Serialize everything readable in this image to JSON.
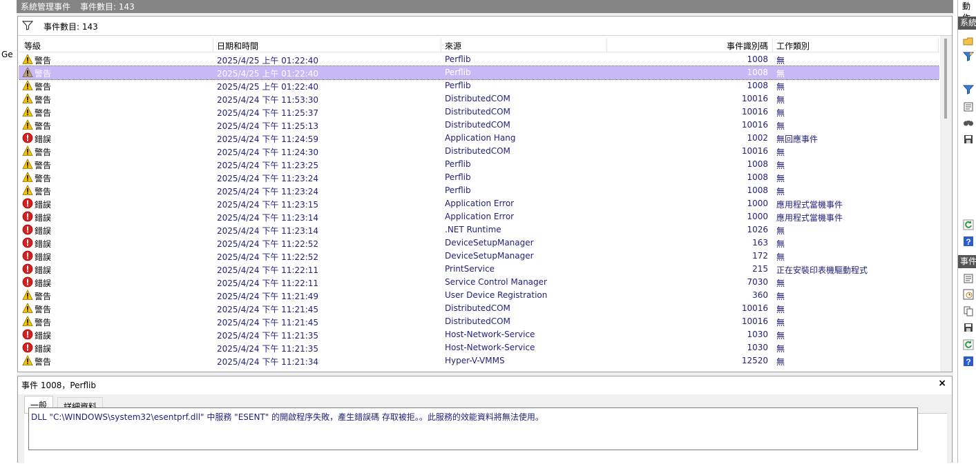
{
  "title_bar": {
    "title": "系統管理事件",
    "count_label": "事件數目: 143"
  },
  "left_strip": {
    "truncated_text": "Ge"
  },
  "filter_bar": {
    "icon": "filter-icon",
    "text": "事件數目: 143"
  },
  "columns": {
    "level": "等級",
    "datetime": "日期和時間",
    "source": "來源",
    "event_id": "事件識別碼",
    "task": "工作類別"
  },
  "events": [
    {
      "level": "警告",
      "type": "warning",
      "datetime": "2025/4/25 上午 01:22:40",
      "source": "Perflib",
      "event_id": "1008",
      "task": "無"
    },
    {
      "level": "警告",
      "type": "warning",
      "datetime": "2025/4/25 上午 01:22:40",
      "source": "Perflib",
      "event_id": "1008",
      "task": "無",
      "selected": true
    },
    {
      "level": "警告",
      "type": "warning",
      "datetime": "2025/4/25 上午 01:22:40",
      "source": "Perflib",
      "event_id": "1008",
      "task": "無"
    },
    {
      "level": "警告",
      "type": "warning",
      "datetime": "2025/4/24 下午 11:53:30",
      "source": "DistributedCOM",
      "event_id": "10016",
      "task": "無"
    },
    {
      "level": "警告",
      "type": "warning",
      "datetime": "2025/4/24 下午 11:25:37",
      "source": "DistributedCOM",
      "event_id": "10016",
      "task": "無"
    },
    {
      "level": "警告",
      "type": "warning",
      "datetime": "2025/4/24 下午 11:25:13",
      "source": "DistributedCOM",
      "event_id": "10016",
      "task": "無"
    },
    {
      "level": "錯誤",
      "type": "error",
      "datetime": "2025/4/24 下午 11:24:59",
      "source": "Application Hang",
      "event_id": "1002",
      "task": "無回應事件"
    },
    {
      "level": "警告",
      "type": "warning",
      "datetime": "2025/4/24 下午 11:24:30",
      "source": "DistributedCOM",
      "event_id": "10016",
      "task": "無"
    },
    {
      "level": "警告",
      "type": "warning",
      "datetime": "2025/4/24 下午 11:23:25",
      "source": "Perflib",
      "event_id": "1008",
      "task": "無"
    },
    {
      "level": "警告",
      "type": "warning",
      "datetime": "2025/4/24 下午 11:23:24",
      "source": "Perflib",
      "event_id": "1008",
      "task": "無"
    },
    {
      "level": "警告",
      "type": "warning",
      "datetime": "2025/4/24 下午 11:23:24",
      "source": "Perflib",
      "event_id": "1008",
      "task": "無"
    },
    {
      "level": "錯誤",
      "type": "error",
      "datetime": "2025/4/24 下午 11:23:15",
      "source": "Application Error",
      "event_id": "1000",
      "task": "應用程式當機事件"
    },
    {
      "level": "錯誤",
      "type": "error",
      "datetime": "2025/4/24 下午 11:23:14",
      "source": "Application Error",
      "event_id": "1000",
      "task": "應用程式當機事件"
    },
    {
      "level": "錯誤",
      "type": "error",
      "datetime": "2025/4/24 下午 11:23:14",
      "source": ".NET Runtime",
      "event_id": "1026",
      "task": "無"
    },
    {
      "level": "錯誤",
      "type": "error",
      "datetime": "2025/4/24 下午 11:22:52",
      "source": "DeviceSetupManager",
      "event_id": "163",
      "task": "無"
    },
    {
      "level": "錯誤",
      "type": "error",
      "datetime": "2025/4/24 下午 11:22:52",
      "source": "DeviceSetupManager",
      "event_id": "172",
      "task": "無"
    },
    {
      "level": "錯誤",
      "type": "error",
      "datetime": "2025/4/24 下午 11:22:11",
      "source": "PrintService",
      "event_id": "215",
      "task": "正在安裝印表機驅動程式"
    },
    {
      "level": "錯誤",
      "type": "error",
      "datetime": "2025/4/24 下午 11:22:11",
      "source": "Service Control Manager",
      "event_id": "7030",
      "task": "無"
    },
    {
      "level": "警告",
      "type": "warning",
      "datetime": "2025/4/24 下午 11:21:49",
      "source": "User Device Registration",
      "event_id": "360",
      "task": "無"
    },
    {
      "level": "警告",
      "type": "warning",
      "datetime": "2025/4/24 下午 11:21:45",
      "source": "DistributedCOM",
      "event_id": "10016",
      "task": "無"
    },
    {
      "level": "警告",
      "type": "warning",
      "datetime": "2025/4/24 下午 11:21:45",
      "source": "DistributedCOM",
      "event_id": "10016",
      "task": "無"
    },
    {
      "level": "錯誤",
      "type": "error",
      "datetime": "2025/4/24 下午 11:21:35",
      "source": "Host-Network-Service",
      "event_id": "1030",
      "task": "無"
    },
    {
      "level": "錯誤",
      "type": "error",
      "datetime": "2025/4/24 下午 11:21:35",
      "source": "Host-Network-Service",
      "event_id": "1030",
      "task": "無"
    },
    {
      "level": "警告",
      "type": "warning",
      "datetime": "2025/4/24 下午 11:21:34",
      "source": "Hyper-V-VMMS",
      "event_id": "12520",
      "task": "無"
    }
  ],
  "detail": {
    "title": "事件 1008，Perflib",
    "close": "×",
    "tabs": {
      "general": "一般",
      "details": "詳細資料"
    },
    "message": "DLL \"C:\\WINDOWS\\system32\\esentprf.dll\" 中服務 \"ESENT\" 的開啟程序失敗，產生錯誤碼 存取被拒。。此服務的效能資料將無法使用。"
  },
  "right_panel": {
    "actions_header": "動作",
    "section1": "系統",
    "section2": "事件"
  },
  "colors": {
    "titlebar": "#858585",
    "selected_row": "#c8b8f5",
    "text_link": "#1f1f7a",
    "warning": "#f5c400",
    "error": "#d81e1e"
  }
}
